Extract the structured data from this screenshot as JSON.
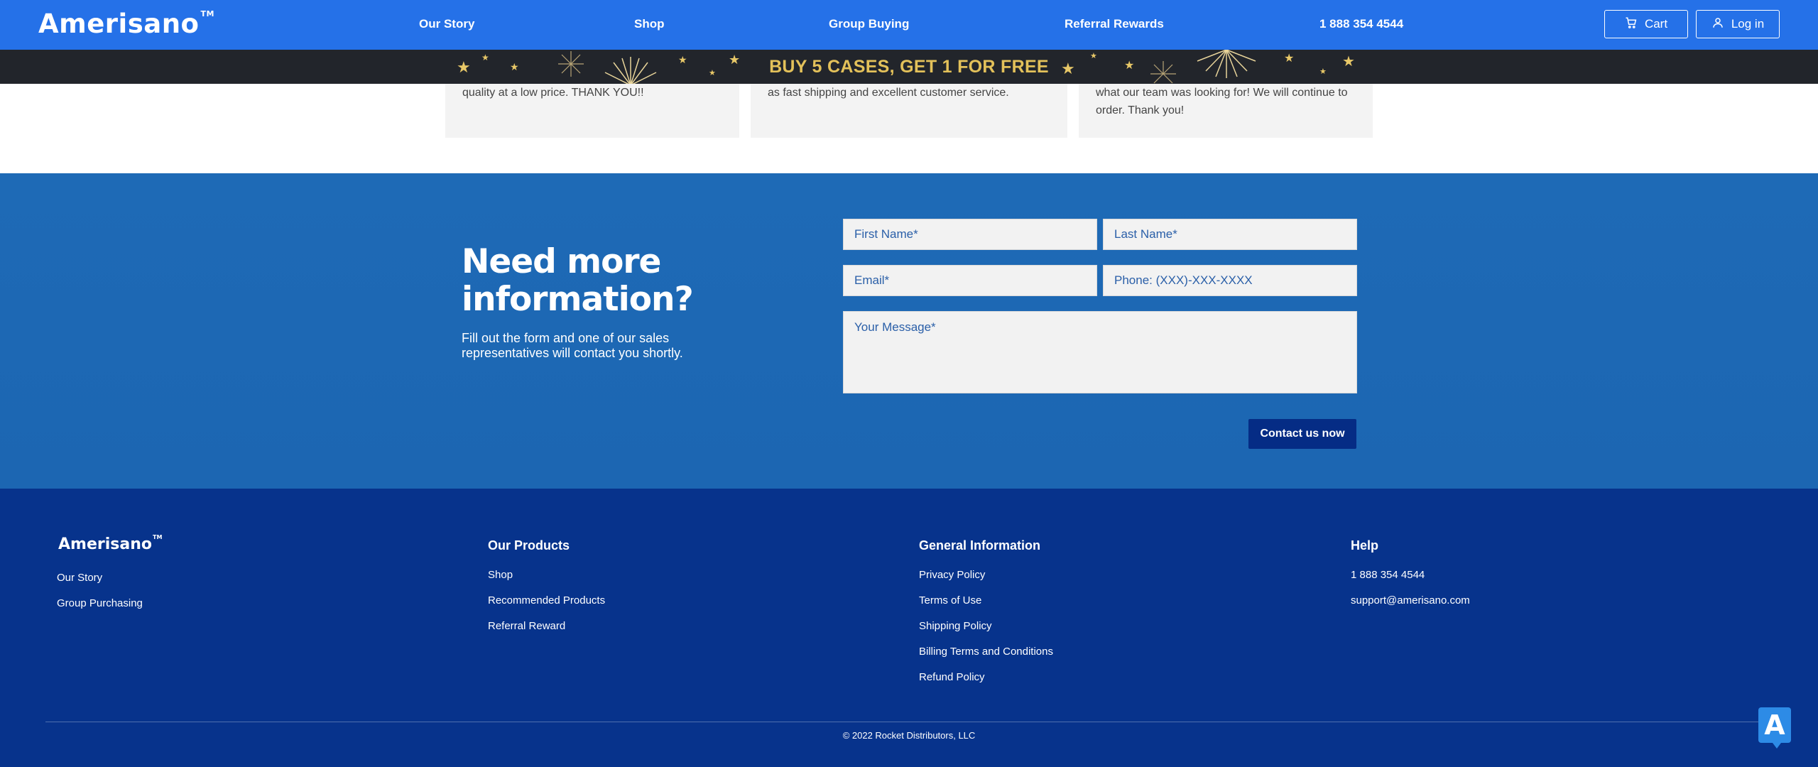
{
  "header": {
    "logo": "Amerisano",
    "logo_tm": "TM",
    "nav": [
      "Our Story",
      "Shop",
      "Group Buying",
      "Referral Rewards",
      "1 888 354 4544"
    ],
    "cart_label": "Cart",
    "login_label": "Log in",
    "icons": {
      "cart": "cart-icon",
      "user": "user-icon"
    }
  },
  "promo": {
    "text": "BUY 5 CASES, GET 1 FOR FREE"
  },
  "testimonials": [
    {
      "text": "quality at a low price. THANK YOU!!"
    },
    {
      "text": "as fast shipping and excellent customer service."
    },
    {
      "text": "what our team was looking for! We will continue to order. Thank you!"
    }
  ],
  "contact": {
    "heading": "Need more information?",
    "subtext": "Fill out the form and one of our sales representatives will contact you shortly.",
    "first_name_placeholder": "First Name*",
    "last_name_placeholder": "Last Name*",
    "email_placeholder": "Email*",
    "phone_placeholder": "Phone: (XXX)-XXX-XXXX",
    "message_placeholder": "Your Message*",
    "submit_label": "Contact us now"
  },
  "footer": {
    "logo": "Amerisano",
    "logo_tm": "TM",
    "col1_links": [
      "Our Story",
      "Group Purchasing"
    ],
    "products_heading": "Our Products",
    "products_links": [
      "Shop",
      "Recommended Products",
      "Referral Reward"
    ],
    "info_heading": "General Information",
    "info_links": [
      "Privacy Policy",
      "Terms of Use",
      "Shipping Policy",
      "Billing Terms and Conditions",
      "Refund Policy"
    ],
    "help_heading": "Help",
    "help_links": [
      "1 888 354 4544",
      "support@amerisano.com"
    ],
    "copyright": "© 2022 Rocket Distributors, LLC"
  },
  "widget": {
    "letter": "A"
  },
  "colors": {
    "header": "#2571e8",
    "promo_bg": "#22252b",
    "promo_text": "#e3c15a",
    "contact_bg": "#1c66b2",
    "footer_bg": "#07338c",
    "button": "#052c85"
  }
}
